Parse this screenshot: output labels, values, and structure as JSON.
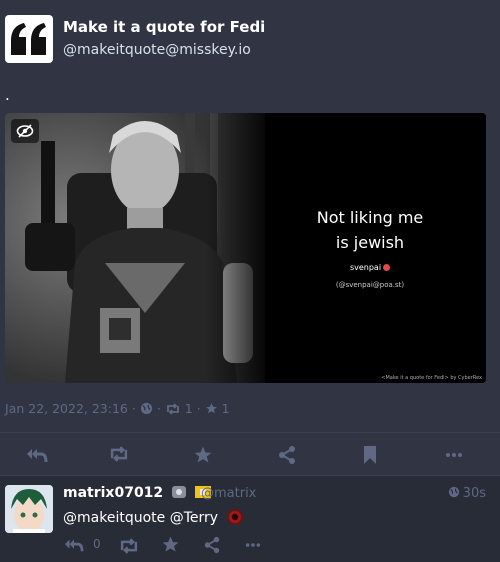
{
  "status": {
    "display_name": "Make it a quote for Fedi",
    "acct": "@makeitquote@misskey.io",
    "content": ".",
    "media": {
      "quote_text": "Not liking me\nis jewish",
      "quote_user": "svenpai",
      "quote_acct": "(@svenpai@poa.st)",
      "footer": "<Make it a quote for Fedi> by CyberRex"
    },
    "timestamp": "Jan 22, 2022, 23:16",
    "reblogs": "1",
    "favourites": "1"
  },
  "reply": {
    "display_name": "matrix07012",
    "acct": "@matrix",
    "time": "30s",
    "content": "@makeitquote @Terry",
    "reply_count": "0"
  },
  "colors": {
    "background": "#282c37",
    "card": "#313543",
    "muted": "#606984",
    "text": "#d9e1e8"
  }
}
